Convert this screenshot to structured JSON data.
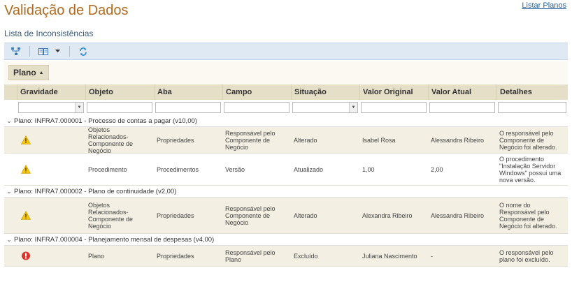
{
  "header": {
    "title": "Validação de Dados",
    "list_plans_link": "Listar Planos"
  },
  "section": {
    "title": "Lista de Inconsistências"
  },
  "toolbar": {
    "buttons": [
      "hierarchy-icon",
      "columns-icon",
      "dropdown-arrow-icon",
      "refresh-icon"
    ]
  },
  "grouping": {
    "chip_label": "Plano",
    "sort_arrow": "▲"
  },
  "columns": [
    "Gravidade",
    "Objeto",
    "Aba",
    "Campo",
    "Situação",
    "Valor Original",
    "Valor Atual",
    "Detalhes"
  ],
  "groups": [
    {
      "label": "Plano: INFRA7.000001 - Processo de contas a pagar (v10,00)",
      "rows": [
        {
          "severity": "warning",
          "objeto": "Objetos Relacionados-Componente de Negócio",
          "aba": "Propriedades",
          "campo": "Responsável pelo Componente de Negócio",
          "situacao": "Alterado",
          "valor_original": "Isabel Rosa",
          "valor_atual": "Alessandra Ribeiro",
          "detalhes": "O responsável pelo Componente de Negócio foi alterado."
        },
        {
          "severity": "warning",
          "objeto": "Procedimento",
          "aba": "Procedimentos",
          "campo": "Versão",
          "situacao": "Atualizado",
          "valor_original": "1,00",
          "valor_atual": "2,00",
          "detalhes": "O procedimento \"Instalação Servidor Windows\" possui uma nova versão."
        }
      ]
    },
    {
      "label": "Plano: INFRA7.000002 - Plano de continuidade (v2,00)",
      "rows": [
        {
          "severity": "warning",
          "objeto": "Objetos Relacionados-Componente de Negócio",
          "aba": "Propriedades",
          "campo": "Responsável pelo Componente de Negócio",
          "situacao": "Alterado",
          "valor_original": "Alexandra Ribeiro",
          "valor_atual": "Alessandra Ribeiro",
          "detalhes": "O nome do Responsável pelo Componente de Negócio foi alterado."
        }
      ]
    },
    {
      "label": "Plano: INFRA7.000004 - Planejamento mensal de despesas (v4,00)",
      "rows": [
        {
          "severity": "error",
          "objeto": "Plano",
          "aba": "Propriedades",
          "campo": "Responsável pelo Plano",
          "situacao": "Excluído",
          "valor_original": "Juliana Nascimento",
          "valor_atual": "-",
          "detalhes": "O responsável pelo plano foi excluído."
        }
      ]
    }
  ],
  "colors": {
    "title": "#b06a1e",
    "toolbar_bg": "#dfe9f3",
    "header_bg": "#e6dfc8",
    "warning": "#f3c40a",
    "error": "#d9352b",
    "link": "#1f5e9e"
  }
}
